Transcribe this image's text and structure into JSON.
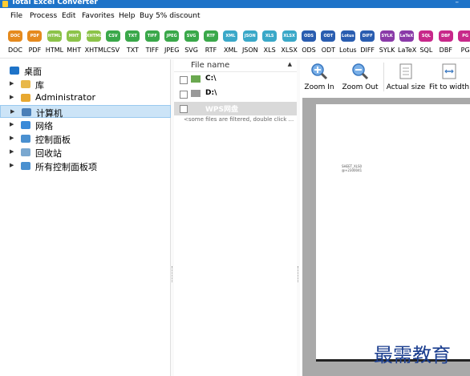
{
  "app": {
    "title": "Total Excel Converter",
    "minimize_symbol": "–"
  },
  "menu": [
    "File",
    "Process",
    "Edit",
    "Favorites",
    "Help",
    "Buy 5% discount"
  ],
  "formats": [
    {
      "label": "DOC",
      "color": "#e58a1e"
    },
    {
      "label": "PDF",
      "color": "#e58a1e"
    },
    {
      "label": "HTML",
      "color": "#8cc34a"
    },
    {
      "label": "MHT",
      "color": "#8cc34a"
    },
    {
      "label": "XHTML",
      "color": "#8cc34a"
    },
    {
      "label": "CSV",
      "color": "#3aa84a"
    },
    {
      "label": "TXT",
      "color": "#3aa84a"
    },
    {
      "label": "TIFF",
      "color": "#3aa84a"
    },
    {
      "label": "JPEG",
      "color": "#3aa84a"
    },
    {
      "label": "SVG",
      "color": "#3aa84a"
    },
    {
      "label": "RTF",
      "color": "#3aa84a"
    },
    {
      "label": "XML",
      "color": "#3aa8c8"
    },
    {
      "label": "JSON",
      "color": "#3aa8c8"
    },
    {
      "label": "XLS",
      "color": "#3aa8c8"
    },
    {
      "label": "XLSX",
      "color": "#3aa8c8"
    },
    {
      "label": "ODS",
      "color": "#2a5db0"
    },
    {
      "label": "ODT",
      "color": "#2a5db0"
    },
    {
      "label": "Lotus",
      "color": "#2a5db0"
    },
    {
      "label": "DIFF",
      "color": "#2a5db0"
    },
    {
      "label": "SYLK",
      "color": "#8a3aa8"
    },
    {
      "label": "LaTeX",
      "color": "#8a3aa8"
    },
    {
      "label": "SQL",
      "color": "#c8288a"
    },
    {
      "label": "DBF",
      "color": "#c8288a"
    },
    {
      "label": "PG",
      "color": "#c8288a"
    }
  ],
  "tree": [
    {
      "label": "桌面",
      "icon": "desktop-icon",
      "color": "#1e73c8",
      "has_arrow": false,
      "selected": false
    },
    {
      "label": "库",
      "icon": "library-icon",
      "color": "#e8b84a",
      "has_arrow": true,
      "selected": false
    },
    {
      "label": "Administrator",
      "icon": "user-folder-icon",
      "color": "#e8a830",
      "has_arrow": true,
      "selected": false
    },
    {
      "label": "计算机",
      "icon": "computer-icon",
      "color": "#4a7fb8",
      "has_arrow": true,
      "selected": true
    },
    {
      "label": "网络",
      "icon": "network-icon",
      "color": "#3a8ad8",
      "has_arrow": true,
      "selected": false
    },
    {
      "label": "控制面板",
      "icon": "control-panel-icon",
      "color": "#4a90d0",
      "has_arrow": true,
      "selected": false
    },
    {
      "label": "回收站",
      "icon": "recycle-bin-icon",
      "color": "#7aa8d0",
      "has_arrow": true,
      "selected": false
    },
    {
      "label": "所有控制面板项",
      "icon": "control-panel-icon",
      "color": "#4a90d0",
      "has_arrow": true,
      "selected": false
    }
  ],
  "file_list": {
    "header": "File name",
    "rows": [
      {
        "label": "C:\\",
        "icon": "drive-c-icon",
        "color": "#6aa84f",
        "selected": false
      },
      {
        "label": "D:\\",
        "icon": "drive-icon",
        "color": "#999999",
        "selected": false
      },
      {
        "label": "WPS网盘",
        "icon": "cloud-drive-icon",
        "color": "#d9d9d9",
        "selected": true
      }
    ],
    "filtered_note": "<some files are filtered, double click ..."
  },
  "viewer": {
    "tools": [
      {
        "label": "Zoom In",
        "icon": "zoom-in-icon"
      },
      {
        "label": "Zoom Out",
        "icon": "zoom-out-icon"
      },
      {
        "label": "Actual size",
        "icon": "actual-size-icon"
      },
      {
        "label": "Fit to width",
        "icon": "fit-to-width-icon"
      }
    ],
    "page_lines": [
      "SHEET_XLS0",
      "@+2300041"
    ]
  },
  "watermark": "最需教育"
}
